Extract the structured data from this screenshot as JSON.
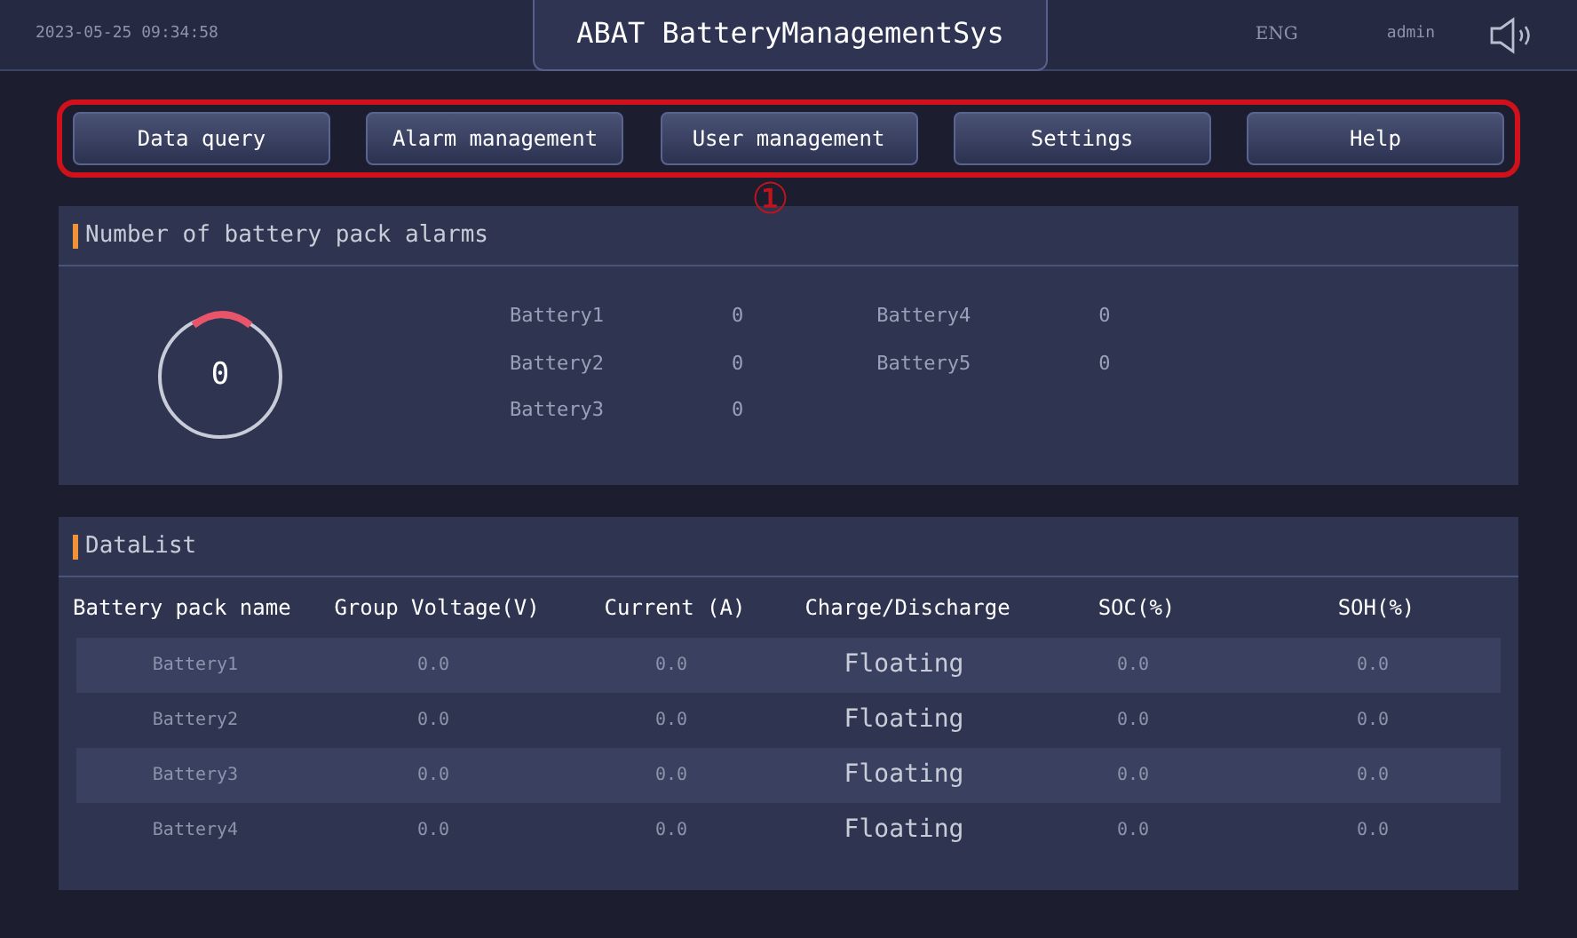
{
  "header": {
    "datetime": "2023-05-25 09:34:58",
    "title": "ABAT BatteryManagementSys",
    "language": "ENG",
    "user": "admin"
  },
  "nav": [
    {
      "label": "Data query"
    },
    {
      "label": "Alarm management"
    },
    {
      "label": "User management"
    },
    {
      "label": "Settings"
    },
    {
      "label": "Help"
    }
  ],
  "callout": "①",
  "alarms": {
    "title": "Number of battery pack alarms",
    "total": "0",
    "items": [
      {
        "name": "Battery1",
        "count": "0"
      },
      {
        "name": "Battery2",
        "count": "0"
      },
      {
        "name": "Battery3",
        "count": "0"
      },
      {
        "name": "Battery4",
        "count": "0"
      },
      {
        "name": "Battery5",
        "count": "0"
      }
    ]
  },
  "datalist": {
    "title": "DataList",
    "columns": [
      "Battery pack name",
      "Group Voltage(V)",
      "Current (A)",
      "Charge/Discharge",
      "SOC(%)",
      "SOH(%)"
    ],
    "rows": [
      [
        "Battery1",
        "0.0",
        "0.0",
        "Floating",
        "0.0",
        "0.0"
      ],
      [
        "Battery2",
        "0.0",
        "0.0",
        "Floating",
        "0.0",
        "0.0"
      ],
      [
        "Battery3",
        "0.0",
        "0.0",
        "Floating",
        "0.0",
        "0.0"
      ],
      [
        "Battery4",
        "0.0",
        "0.0",
        "Floating",
        "0.0",
        "0.0"
      ]
    ]
  }
}
